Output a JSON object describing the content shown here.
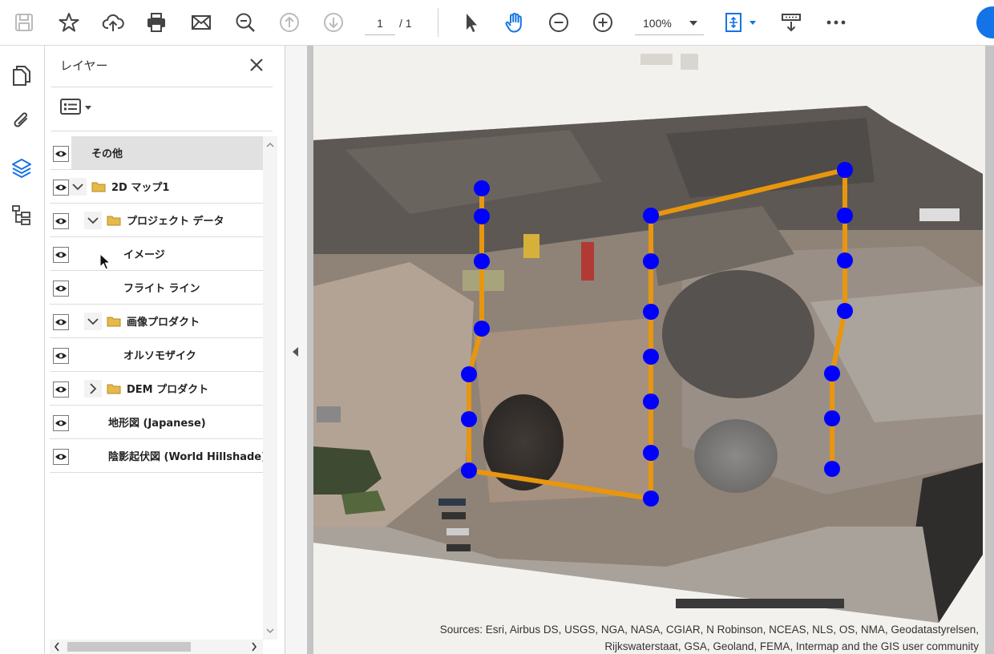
{
  "toolbar": {
    "page_current": "1",
    "page_total": "/ 1",
    "zoom": "100%"
  },
  "panel": {
    "title": "レイヤー",
    "layers": [
      {
        "label": "その他"
      },
      {
        "label": "2D マップ1"
      },
      {
        "label": "プロジェクト データ"
      },
      {
        "label": "イメージ"
      },
      {
        "label": "フライト ライン"
      },
      {
        "label": "画像プロダクト"
      },
      {
        "label": "オルソモザイク"
      },
      {
        "label": "DEM プロダクト"
      },
      {
        "label": "地形図 (Japanese)"
      },
      {
        "label": "陰影起伏図 (World Hillshade)"
      }
    ]
  },
  "map": {
    "attribution_line1": "Sources: Esri, Airbus DS, USGS, NGA, NASA, CGIAR, N Robinson, NCEAS, NLS, OS, NMA, Geodatastyrelsen,",
    "attribution_line2": "Rijkswaterstaat, GSA, Geoland, FEMA, Intermap and the GIS user community",
    "line_color": "#e8960e",
    "point_color": "#0000ff"
  },
  "colors": {
    "accent": "#1473e6",
    "folder": "#e5b94a"
  }
}
